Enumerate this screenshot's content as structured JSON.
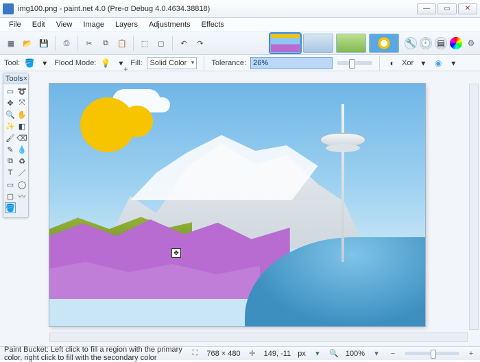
{
  "title": "img100.png - paint.net 4.0 (Pre-α Debug 4.0.4634.38818)",
  "menu": [
    "File",
    "Edit",
    "View",
    "Image",
    "Layers",
    "Adjustments",
    "Effects"
  ],
  "options": {
    "tool_label": "Tool:",
    "flood_label": "Flood Mode:",
    "fill_label": "Fill:",
    "fill_value": "Solid Color",
    "tolerance_label": "Tolerance:",
    "tolerance_value": "26%",
    "xor_label": "Xor"
  },
  "tools_panel_title": "Tools",
  "status": {
    "hint": "Paint Bucket: Left click to fill a region with the primary color, right click to fill with the secondary color",
    "size": "768 × 480",
    "cursor": "149, -11",
    "unit": "px",
    "zoom": "100%"
  }
}
